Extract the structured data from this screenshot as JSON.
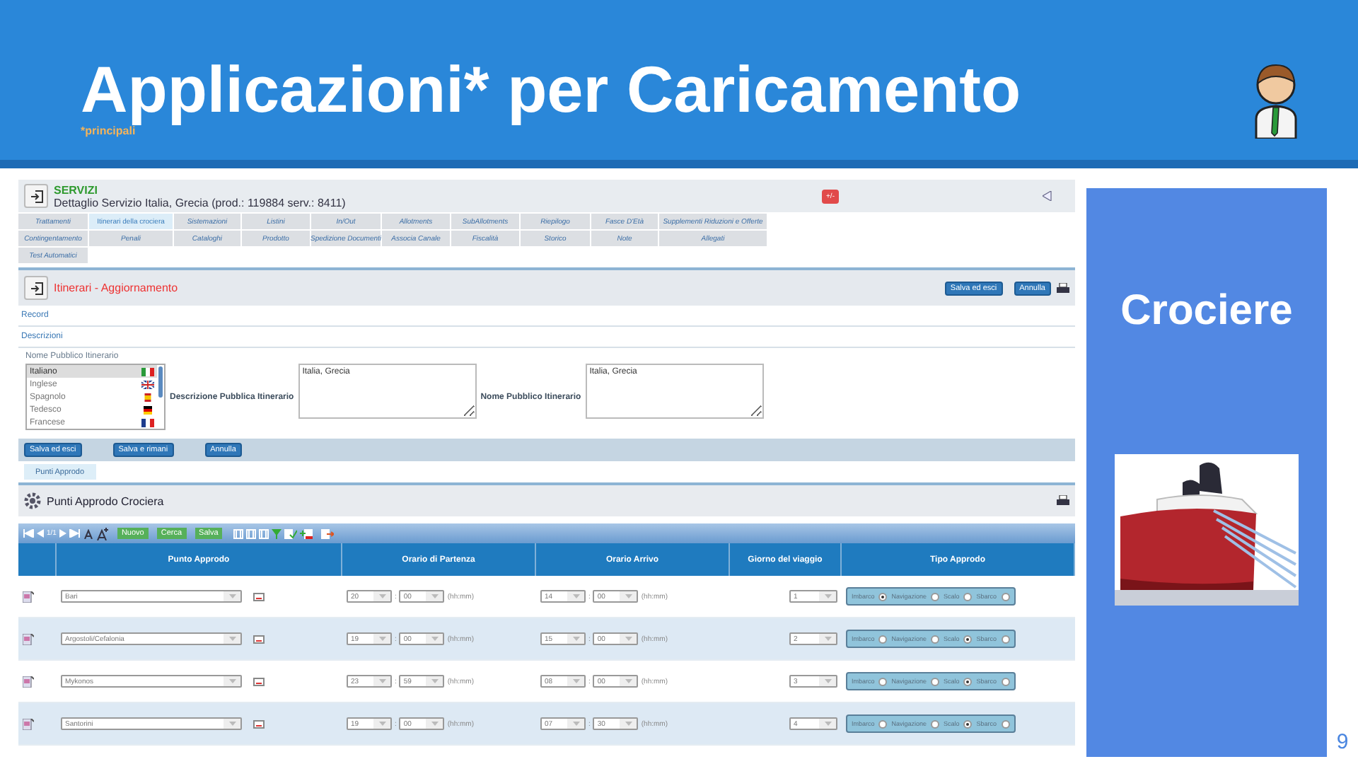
{
  "slide": {
    "title": "Applicazioni* per Caricamento",
    "footnote": "*principali",
    "page_number": "9"
  },
  "side_panel": {
    "title": "Crociere"
  },
  "app": {
    "section": "SERVIZI",
    "heading": "Dettaglio Servizio Italia, Grecia (prod.: 119884 serv.: 8411)",
    "badge": "+/-",
    "tab_rows": [
      {
        "tabs": [
          {
            "label": "Trattamenti",
            "selected": false
          },
          {
            "label": "Itinerari della crociera",
            "selected": true
          },
          {
            "label": "Sistemazioni",
            "selected": false
          },
          {
            "label": "Listini",
            "selected": false
          },
          {
            "label": "In/Out",
            "selected": false
          },
          {
            "label": "Allotments",
            "selected": false
          },
          {
            "label": "SubAllotments",
            "selected": false
          },
          {
            "label": "Riepilogo",
            "selected": false
          },
          {
            "label": "Fasce D'Età",
            "selected": false
          },
          {
            "label": "Supplementi Riduzioni e Offerte",
            "selected": false
          }
        ]
      },
      {
        "tabs": [
          {
            "label": "Contingentamento",
            "selected": false
          },
          {
            "label": "Penali",
            "selected": false
          },
          {
            "label": "Cataloghi",
            "selected": false
          },
          {
            "label": "Prodotto",
            "selected": false
          },
          {
            "label": "Spedizione Documenti",
            "selected": false
          },
          {
            "label": "Associa Canale",
            "selected": false
          },
          {
            "label": "Fiscalità",
            "selected": false
          },
          {
            "label": "Storico",
            "selected": false
          },
          {
            "label": "Note",
            "selected": false
          },
          {
            "label": "Allegati",
            "selected": false
          }
        ]
      },
      {
        "tabs": [
          {
            "label": "Test Automatici",
            "selected": false
          }
        ]
      }
    ],
    "form_title": "Itinerari - Aggiornamento",
    "top_buttons": [
      "Salva ed esci",
      "Annulla"
    ],
    "links": [
      "Record",
      "Descrizioni"
    ],
    "languages_label": "Nome Pubblico Itinerario",
    "languages": [
      {
        "name": "Italiano",
        "kind": "it",
        "selected": true
      },
      {
        "name": "Inglese",
        "kind": "gb",
        "selected": false
      },
      {
        "name": "Spagnolo",
        "kind": "es",
        "selected": false
      },
      {
        "name": "Tedesco",
        "kind": "de",
        "selected": false
      },
      {
        "name": "Francese",
        "kind": "fr",
        "selected": false
      }
    ],
    "fields": [
      {
        "label": "Descrizione Pubblica Itinerario",
        "value": "Italia, Grecia"
      },
      {
        "label": "Nome Pubblico Itinerario",
        "value": "Italia, Grecia"
      }
    ],
    "bottom_buttons": [
      "Salva ed esci",
      "Salva e rimani",
      "Annulla"
    ],
    "subtabs": [
      {
        "label": "Punti Approdo",
        "selected": true
      }
    ],
    "grid_title": "Punti Approdo Crociera",
    "toolbar": {
      "pager": "1/1",
      "buttons": [
        "Nuovo",
        "Cerca",
        "Salva"
      ]
    },
    "columns": [
      "Punto Approdo",
      "Orario di Partenza",
      "Orario Arrivo",
      "Giorno del viaggio",
      "Tipo Approdo"
    ],
    "rows": [
      {
        "port": "Bari",
        "departure": {
          "hh": "20",
          "sep": ":",
          "mm": "00",
          "hint": "(hh:mm)"
        },
        "arrival": {
          "hh": "14",
          "sep": ":",
          "mm": "00",
          "hint": "(hh:mm)"
        },
        "day": "1",
        "types": [
          {
            "label": "Imbarco",
            "selected": true
          },
          {
            "label": "Navigazione",
            "selected": false
          },
          {
            "label": "Scalo",
            "selected": false
          },
          {
            "label": "Sbarco",
            "selected": false
          }
        ]
      },
      {
        "port": "Argostoli/Cefalonia",
        "departure": {
          "hh": "19",
          "sep": ":",
          "mm": "00",
          "hint": "(hh:mm)"
        },
        "arrival": {
          "hh": "15",
          "sep": ":",
          "mm": "00",
          "hint": "(hh:mm)"
        },
        "day": "2",
        "types": [
          {
            "label": "Imbarco",
            "selected": false
          },
          {
            "label": "Navigazione",
            "selected": false
          },
          {
            "label": "Scalo",
            "selected": true
          },
          {
            "label": "Sbarco",
            "selected": false
          }
        ]
      },
      {
        "port": "Mykonos",
        "departure": {
          "hh": "23",
          "sep": ":",
          "mm": "59",
          "hint": "(hh:mm)"
        },
        "arrival": {
          "hh": "08",
          "sep": ":",
          "mm": "00",
          "hint": "(hh:mm)"
        },
        "day": "3",
        "types": [
          {
            "label": "Imbarco",
            "selected": false
          },
          {
            "label": "Navigazione",
            "selected": false
          },
          {
            "label": "Scalo",
            "selected": true
          },
          {
            "label": "Sbarco",
            "selected": false
          }
        ]
      },
      {
        "port": "Santorini",
        "departure": {
          "hh": "19",
          "sep": ":",
          "mm": "00",
          "hint": "(hh:mm)"
        },
        "arrival": {
          "hh": "07",
          "sep": ":",
          "mm": "30",
          "hint": "(hh:mm)"
        },
        "day": "4",
        "types": [
          {
            "label": "Imbarco",
            "selected": false
          },
          {
            "label": "Navigazione",
            "selected": false
          },
          {
            "label": "Scalo",
            "selected": true
          },
          {
            "label": "Sbarco",
            "selected": false
          }
        ]
      }
    ]
  }
}
